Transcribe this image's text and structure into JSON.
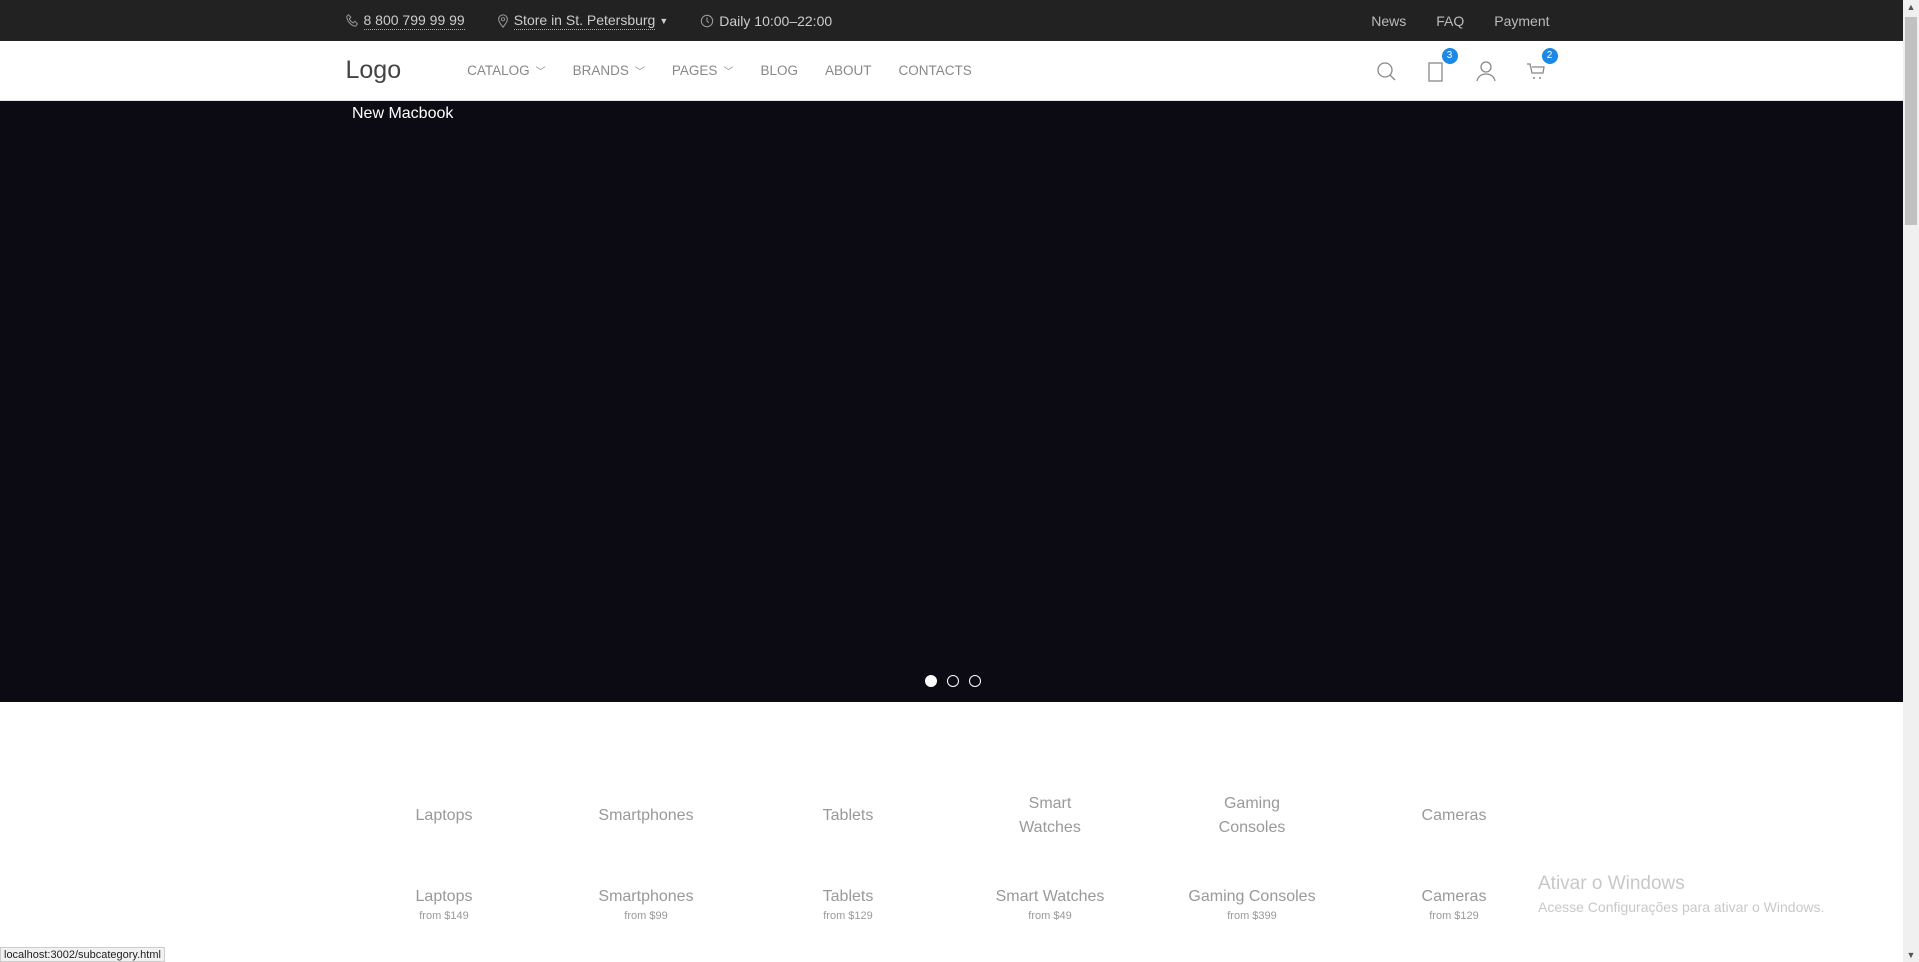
{
  "topbar": {
    "phone": "8 800 799 99 99",
    "store": "Store in St. Petersburg",
    "hours": "Daily 10:00–22:00",
    "links": [
      "News",
      "FAQ",
      "Payment"
    ]
  },
  "nav": {
    "logo": "Logo",
    "menu": [
      "CATALOG",
      "BRANDS",
      "PAGES",
      "BLOG",
      "ABOUT",
      "CONTACTS"
    ],
    "compare_count": "3",
    "cart_count": "2"
  },
  "hero": {
    "title": "New Macbook",
    "slides": 3,
    "active_slide": 1
  },
  "categories": [
    "Laptops",
    "Smartphones",
    "Tablets",
    "Smart Watches",
    "Gaming Consoles",
    "Cameras"
  ],
  "category_cards": [
    {
      "name": "Laptops",
      "price": "from $149"
    },
    {
      "name": "Smartphones",
      "price": "from $99"
    },
    {
      "name": "Tablets",
      "price": "from $129"
    },
    {
      "name": "Smart Watches",
      "price": "from $49"
    },
    {
      "name": "Gaming Consoles",
      "price": "from $399"
    },
    {
      "name": "Cameras",
      "price": "from $129"
    }
  ],
  "windows": {
    "title": "Ativar o Windows",
    "subtitle": "Acesse Configurações para ativar o Windows."
  },
  "status_url": "localhost:3002/subcategory.html",
  "colors": {
    "accent": "#1e88e5",
    "hero_bg": "#0c0b14",
    "topbar_bg": "#222222"
  }
}
